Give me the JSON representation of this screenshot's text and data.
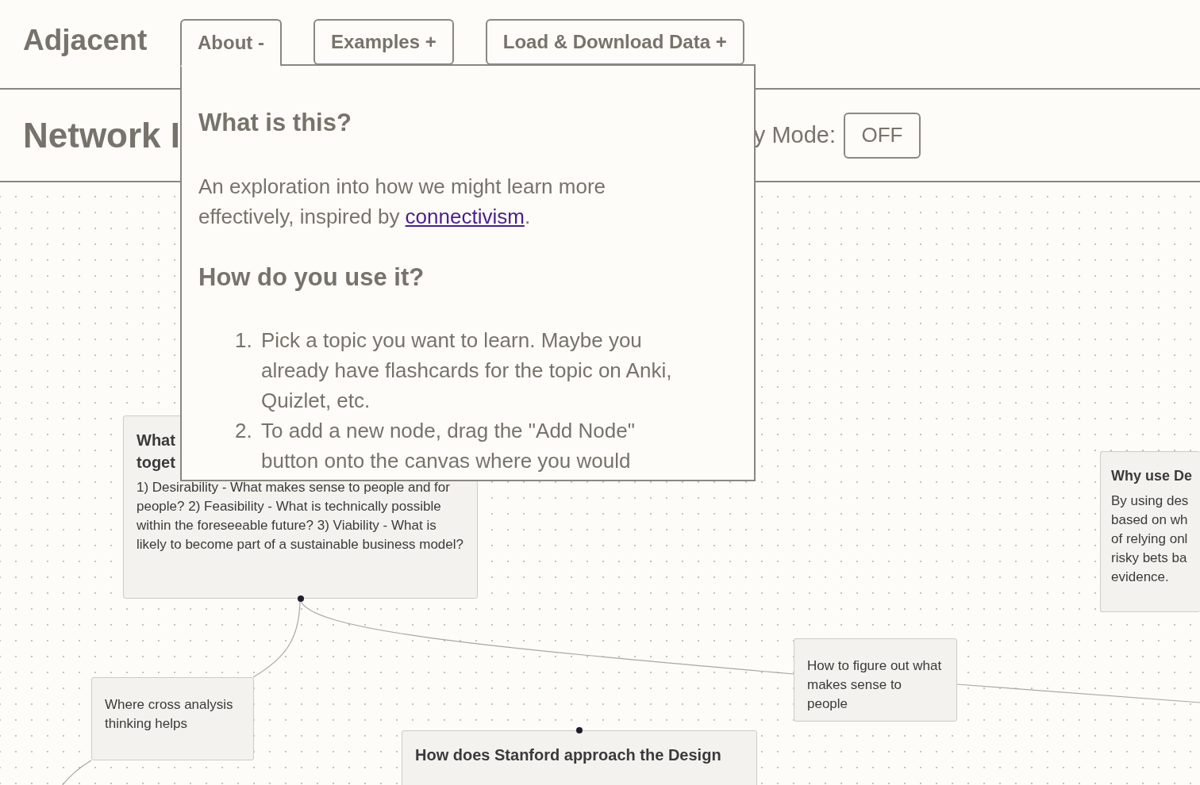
{
  "app": {
    "logo": "Adjacent"
  },
  "menu": [
    {
      "label": "About -",
      "expanded": true
    },
    {
      "label": "Examples +",
      "expanded": false
    },
    {
      "label": "Load & Download Data +",
      "expanded": false
    }
  ],
  "about_panel": {
    "sections": [
      {
        "kind": "heading",
        "text": "What is this?"
      },
      {
        "kind": "paragraph",
        "text": "An exploration into how we might learn more effectively, inspired by ",
        "link": "connectivism",
        "after": "."
      },
      {
        "kind": "heading",
        "text": "How do you use it?"
      },
      {
        "kind": "list",
        "items": [
          {
            "number": "1.",
            "text": "Pick a topic you want to learn. Maybe you already have flashcards for the topic on Anki, Quizlet, etc."
          },
          {
            "number": "2.",
            "text": "To add a new node, drag the \"Add Node\" button onto the canvas where you would"
          }
        ]
      }
    ]
  },
  "toolbar": {
    "title": "Network I",
    "mode_label": "y Mode:",
    "mode_toggle": {
      "label": "OFF",
      "on": false
    }
  },
  "canvas": {
    "nodes": [
      {
        "title": "What toget",
        "body": [
          "1) Desirability - What makes sense to people and for people? 2) Feasibility - What is technically possible within the foreseeable future? 3) Viability - What is likely to become part of a sustainable business model?"
        ]
      },
      {
        "body": [
          "Where cross analysis thinking helps"
        ]
      },
      {
        "body": [
          "How to figure out what makes sense to people"
        ]
      },
      {
        "title": "How does Stanford approach the Design"
      },
      {
        "title": "Why use De",
        "body": [
          "By using des",
          "based on wh",
          "of relying onl",
          "risky bets ba",
          "evidence."
        ]
      }
    ]
  }
}
